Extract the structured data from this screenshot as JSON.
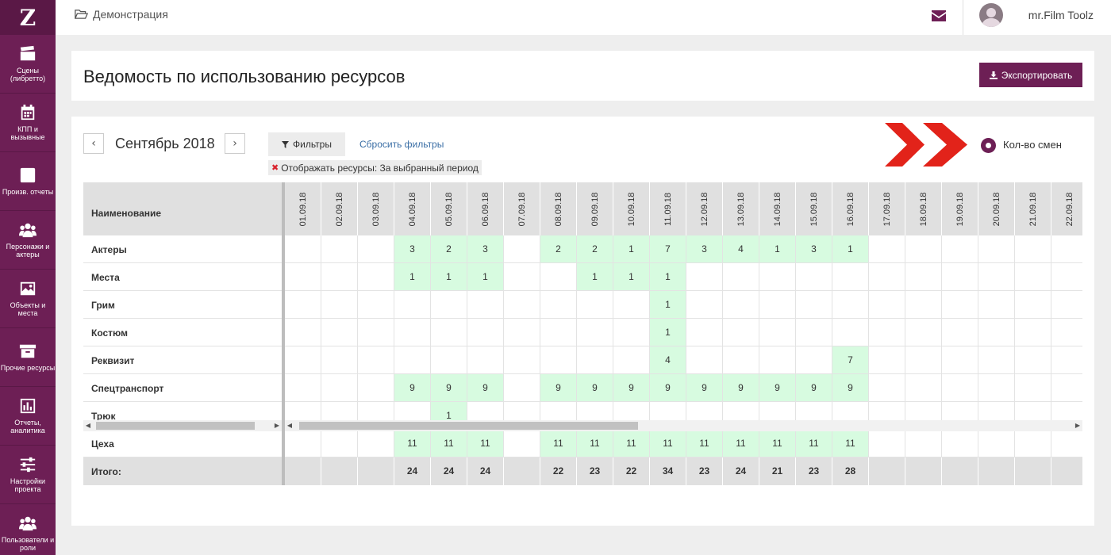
{
  "logo": "Z",
  "sidebar": {
    "items": [
      {
        "label": "Сцены (либретто)",
        "icon": "clapperboard-icon"
      },
      {
        "label": "КПП и вызывные",
        "icon": "calendar-icon"
      },
      {
        "label": "Произв. отчеты",
        "icon": "check-square-icon"
      },
      {
        "label": "Персонажи и актеры",
        "icon": "users-icon"
      },
      {
        "label": "Объекты и места",
        "icon": "image-icon"
      },
      {
        "label": "Прочие ресурсы",
        "icon": "archive-icon"
      },
      {
        "label": "Отчеты, аналитика",
        "icon": "bar-chart-icon"
      },
      {
        "label": "Настройки проекта",
        "icon": "sliders-icon"
      },
      {
        "label": "Пользователи и роли",
        "icon": "users-icon"
      }
    ]
  },
  "topbar": {
    "breadcrumb": "Демонстрация",
    "username": "mr.Film Toolz"
  },
  "title_panel": {
    "title": "Ведомость по использованию ресурсов",
    "export_label": "Экспортировать"
  },
  "toolbar": {
    "prev": "‹",
    "next": "›",
    "month": "Сентябрь 2018",
    "filters_label": "Фильтры",
    "reset_label": "Сбросить фильтры",
    "chip_label": "Отображать ресурсы:",
    "chip_value": "За выбранный период",
    "radio_label": "Кол-во смен",
    "accent_color": "#6d1f55",
    "annotation_color": "#e2231a"
  },
  "table": {
    "name_header": "Наименование",
    "total_label": "Итого:",
    "dates": [
      "01.09.18",
      "02.09.18",
      "03.09.18",
      "04.09.18",
      "05.09.18",
      "06.09.18",
      "07.09.18",
      "08.09.18",
      "09.09.18",
      "10.09.18",
      "11.09.18",
      "12.09.18",
      "13.09.18",
      "14.09.18",
      "15.09.18",
      "16.09.18",
      "17.09.18",
      "18.09.18",
      "19.09.18",
      "20.09.18",
      "21.09.18",
      "22.09.18"
    ],
    "rows": [
      {
        "name": "Актеры",
        "values": [
          "",
          "",
          "",
          "3",
          "2",
          "3",
          "",
          "2",
          "2",
          "1",
          "7",
          "3",
          "4",
          "1",
          "3",
          "1",
          "",
          "",
          "",
          "",
          "",
          ""
        ]
      },
      {
        "name": "Места",
        "values": [
          "",
          "",
          "",
          "1",
          "1",
          "1",
          "",
          "",
          "1",
          "1",
          "1",
          "",
          "",
          "",
          "",
          "",
          "",
          "",
          "",
          "",
          "",
          ""
        ]
      },
      {
        "name": "Грим",
        "values": [
          "",
          "",
          "",
          "",
          "",
          "",
          "",
          "",
          "",
          "",
          "1",
          "",
          "",
          "",
          "",
          "",
          "",
          "",
          "",
          "",
          "",
          ""
        ]
      },
      {
        "name": "Костюм",
        "values": [
          "",
          "",
          "",
          "",
          "",
          "",
          "",
          "",
          "",
          "",
          "1",
          "",
          "",
          "",
          "",
          "",
          "",
          "",
          "",
          "",
          "",
          ""
        ]
      },
      {
        "name": "Реквизит",
        "values": [
          "",
          "",
          "",
          "",
          "",
          "",
          "",
          "",
          "",
          "",
          "4",
          "",
          "",
          "",
          "",
          "7",
          "",
          "",
          "",
          "",
          "",
          ""
        ]
      },
      {
        "name": "Спецтранспорт",
        "values": [
          "",
          "",
          "",
          "9",
          "9",
          "9",
          "",
          "9",
          "9",
          "9",
          "9",
          "9",
          "9",
          "9",
          "9",
          "9",
          "",
          "",
          "",
          "",
          "",
          ""
        ]
      },
      {
        "name": "Трюк",
        "values": [
          "",
          "",
          "",
          "",
          "1",
          "",
          "",
          "",
          "",
          "",
          "",
          "",
          "",
          "",
          "",
          "",
          "",
          "",
          "",
          "",
          "",
          ""
        ]
      },
      {
        "name": "Цеха",
        "values": [
          "",
          "",
          "",
          "11",
          "11",
          "11",
          "",
          "11",
          "11",
          "11",
          "11",
          "11",
          "11",
          "11",
          "11",
          "11",
          "",
          "",
          "",
          "",
          "",
          ""
        ]
      }
    ],
    "totals": [
      "",
      "",
      "",
      "24",
      "24",
      "24",
      "",
      "22",
      "23",
      "22",
      "34",
      "23",
      "24",
      "21",
      "23",
      "28",
      "",
      "",
      "",
      "",
      "",
      ""
    ],
    "highlight_color": "#d7fbe0"
  }
}
